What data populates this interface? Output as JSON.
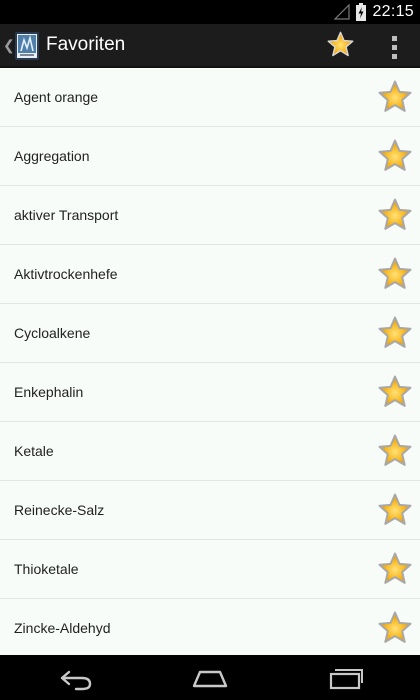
{
  "status_bar": {
    "time": "22:15"
  },
  "action_bar": {
    "title": "Favoriten"
  },
  "favorites": [
    {
      "label": "Agent orange"
    },
    {
      "label": "Aggregation"
    },
    {
      "label": "aktiver Transport"
    },
    {
      "label": "Aktivtrockenhefe"
    },
    {
      "label": "Cycloalkene"
    },
    {
      "label": "Enkephalin"
    },
    {
      "label": "Ketale"
    },
    {
      "label": "Reinecke-Salz"
    },
    {
      "label": "Thioketale"
    },
    {
      "label": "Zincke-Aldehyd"
    }
  ],
  "icons": {
    "favorite_star": "star-icon",
    "back": "back-icon",
    "home": "home-icon",
    "recents": "recents-icon",
    "overflow": "overflow-menu-icon",
    "signal": "signal-icon",
    "battery": "battery-icon"
  },
  "colors": {
    "star_fill": "#f7b21a",
    "star_outline": "#a8a8a8",
    "list_background": "#f8fcf8",
    "action_bar": "#1c1c1c"
  }
}
